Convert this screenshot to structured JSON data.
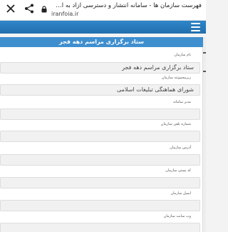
{
  "browser": {
    "title": "فهرست سازمان ها - سامانه انتشار و دسترسی آزاد به اطلا...",
    "url": "iranfoia.ir"
  },
  "form": {
    "header": "ستاد برگزاری مراسم دهه فجر",
    "fields": [
      {
        "label": "نام سازمان",
        "value": "ستاد برگزاری مراسم دهه فجر"
      },
      {
        "label": "زیرمجموعه سازمان",
        "value": "شورای هماهنگی تبلیغات اسلامی"
      },
      {
        "label": "مدیر سامانه",
        "value": ""
      },
      {
        "label": "شماره تلفن سازمان",
        "value": ""
      },
      {
        "label": "آدرس سازمان",
        "value": ""
      },
      {
        "label": "کد پستی سازمان",
        "value": ""
      },
      {
        "label": "ایمیل سازمان",
        "value": ""
      },
      {
        "label": "وب سایت سازمان",
        "value": ""
      }
    ]
  },
  "icons": {
    "close": "close-icon",
    "share": "share-icon",
    "lock": "lock-icon",
    "menu": "hamburger-menu-icon"
  },
  "colors": {
    "nav": "#2a7bbd",
    "header": "#3f8fcf"
  }
}
